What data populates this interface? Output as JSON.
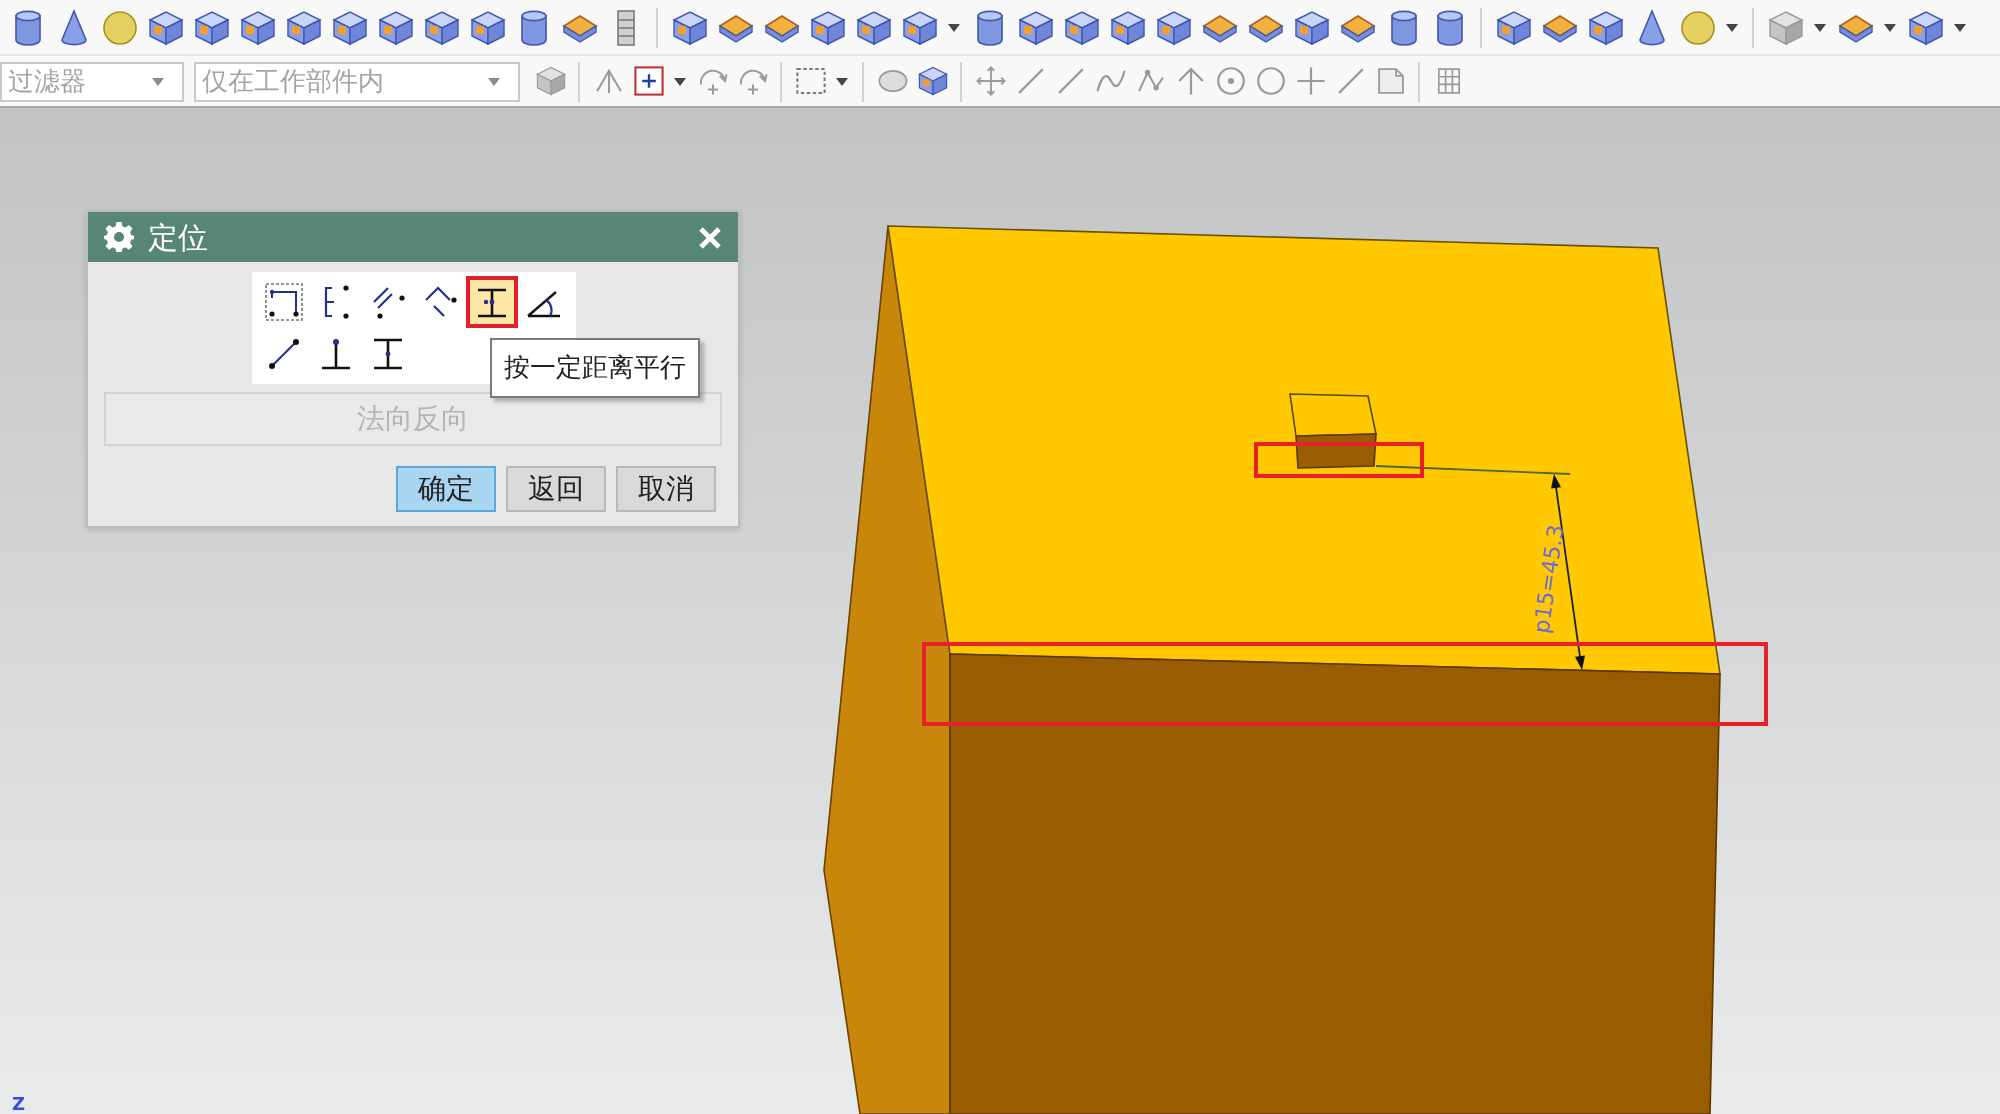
{
  "toolbar": {
    "filter_dropdown": {
      "value": "过滤器",
      "disabled": true
    },
    "scope_dropdown": {
      "value": "仅在工作部件内",
      "disabled": true
    }
  },
  "dialog": {
    "title": "定位",
    "methods": [
      {
        "selected": false
      },
      {
        "selected": false
      },
      {
        "selected": false
      },
      {
        "selected": false
      },
      {
        "selected": true
      },
      {
        "selected": false
      },
      {
        "selected": false
      },
      {
        "selected": false
      },
      {
        "selected": false
      }
    ],
    "tooltip": "按一定距离平行",
    "reverse_button": {
      "label": "法向反向",
      "disabled": true
    },
    "buttons": [
      {
        "label": "确定",
        "selected": true
      },
      {
        "label": "返回",
        "selected": false
      },
      {
        "label": "取消",
        "selected": false
      }
    ]
  },
  "viewport": {
    "dimension": "p15=45.3",
    "axis_label": "Z"
  }
}
